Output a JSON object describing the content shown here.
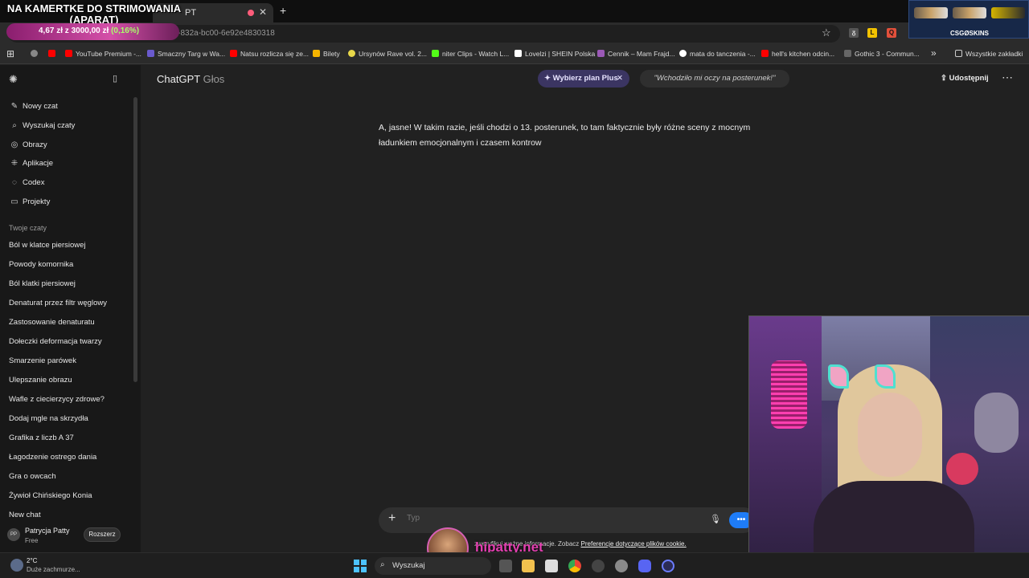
{
  "overlay": {
    "title": "NA KAMERTKE DO STRIMOWANIA (APARAT)",
    "donation_amount": "4,67 zł z 3000,00 zł",
    "donation_pct": "(0,16%)",
    "csgo_label": "CSGØSKINS"
  },
  "browser": {
    "tab_title": "PT",
    "url": "8-2224-832a-bc00-6e92e4830318",
    "bookmarks": [
      "YouTube Premium -...",
      "Smaczny Targ w Wa...",
      "Natsu rozlicza się ze...",
      "Bilety",
      "Ursynów Rave vol. 2...",
      "niter Clips - Watch L...",
      "Lovelzi | SHEIN Polska",
      "Cennik – Mam Frajd...",
      "mata do tanczenia -...",
      "hell's kitchen odcin...",
      "Gothic 3 - Commun...",
      "Wszystkie zakładki"
    ]
  },
  "sidebar": {
    "items": [
      "Nowy czat",
      "Wyszukaj czaty",
      "Obrazy",
      "Aplikacje",
      "Codex",
      "Projekty"
    ],
    "section_label": "Twoje czaty",
    "chats": [
      "Ból w klatce piersiowej",
      "Powody komornika",
      "Ból klatki piersiowej",
      "Denaturat przez filtr węglowy",
      "Zastosowanie denaturatu",
      "Dołeczki deformacja twarzy",
      "Smarzenie parówek",
      "Ulepszanie obrazu",
      "Wafle z ciecierzycy zdrowe?",
      "Dodaj mgle na skrzydła",
      "Grafika z liczb A 37",
      "Łagodzenie ostrego dania",
      "Gra o owcach",
      "Żywioł Chińskiego Konia",
      "New chat"
    ],
    "user": {
      "initials": "PP",
      "name": "Patrycja Patty",
      "plan": "Free",
      "upgrade_label": "Rozszerz"
    }
  },
  "header": {
    "title": "ChatGPT",
    "subtitle": "Głos",
    "plan_button": "Wybierz plan Plus",
    "quote": "\"Wchodziło mi oczy na posterunek!\"",
    "share": "Udostępnij"
  },
  "conversation": {
    "message": "A, jasne! W takim razie, jeśli chodzi o 13. posterunek, to tam faktycznie były różne sceny z mocnym ładunkiem emocjonalnym i czasem kontrow"
  },
  "composer": {
    "placeholder": "Typ",
    "disclaimer_text": "zweryfikuj ważne informacje. Zobacz",
    "disclaimer_link": "Preferencje dotyczące plików cookie."
  },
  "watermark": {
    "text": "hipatty.net"
  },
  "taskbar": {
    "temperature": "2°C",
    "weather": "Duże zachmurze...",
    "search_label": "Wyszukaj"
  }
}
